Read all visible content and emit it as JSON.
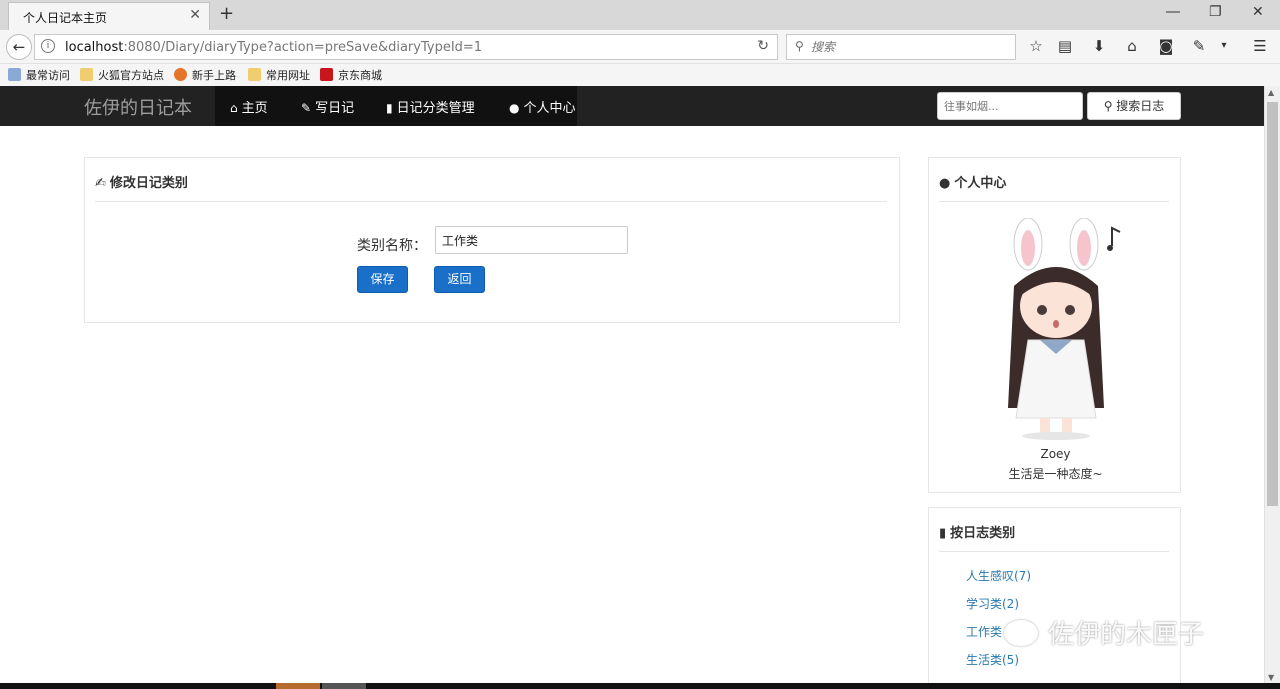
{
  "browser": {
    "tab_title": "个人日记本主页",
    "tab_close": "✕",
    "new_tab": "+",
    "url_host": "localhost",
    "url_rest": ":8080/Diary/diaryType?action=preSave&diaryTypeId=1",
    "search_placeholder": "搜索",
    "bookmarks": [
      "最常访问",
      "火狐官方站点",
      "新手上路",
      "常用网址",
      "京东商城"
    ]
  },
  "site": {
    "brand": "佐伊的日记本",
    "nav": [
      "主页",
      "写日记",
      "日记分类管理",
      "个人中心"
    ],
    "search_placeholder": "往事如烟...",
    "search_button": "搜索日志"
  },
  "form": {
    "title": "修改日记类别",
    "label": "类别名称：",
    "value": "工作类",
    "save": "保存",
    "back": "返回"
  },
  "sidebar": {
    "profile_title": "个人中心",
    "user_name": "Zoey",
    "user_motto": "生活是一种态度~",
    "category_title": "按日志类别",
    "categories": [
      "人生感叹(7)",
      "学习类(2)",
      "工作类",
      "生活类(5)"
    ]
  },
  "watermark": "佐伊的木匣子",
  "colors": {
    "nav_bg": "#222222",
    "primary_button": "#1a6fc9",
    "link": "#2a7ab0"
  }
}
